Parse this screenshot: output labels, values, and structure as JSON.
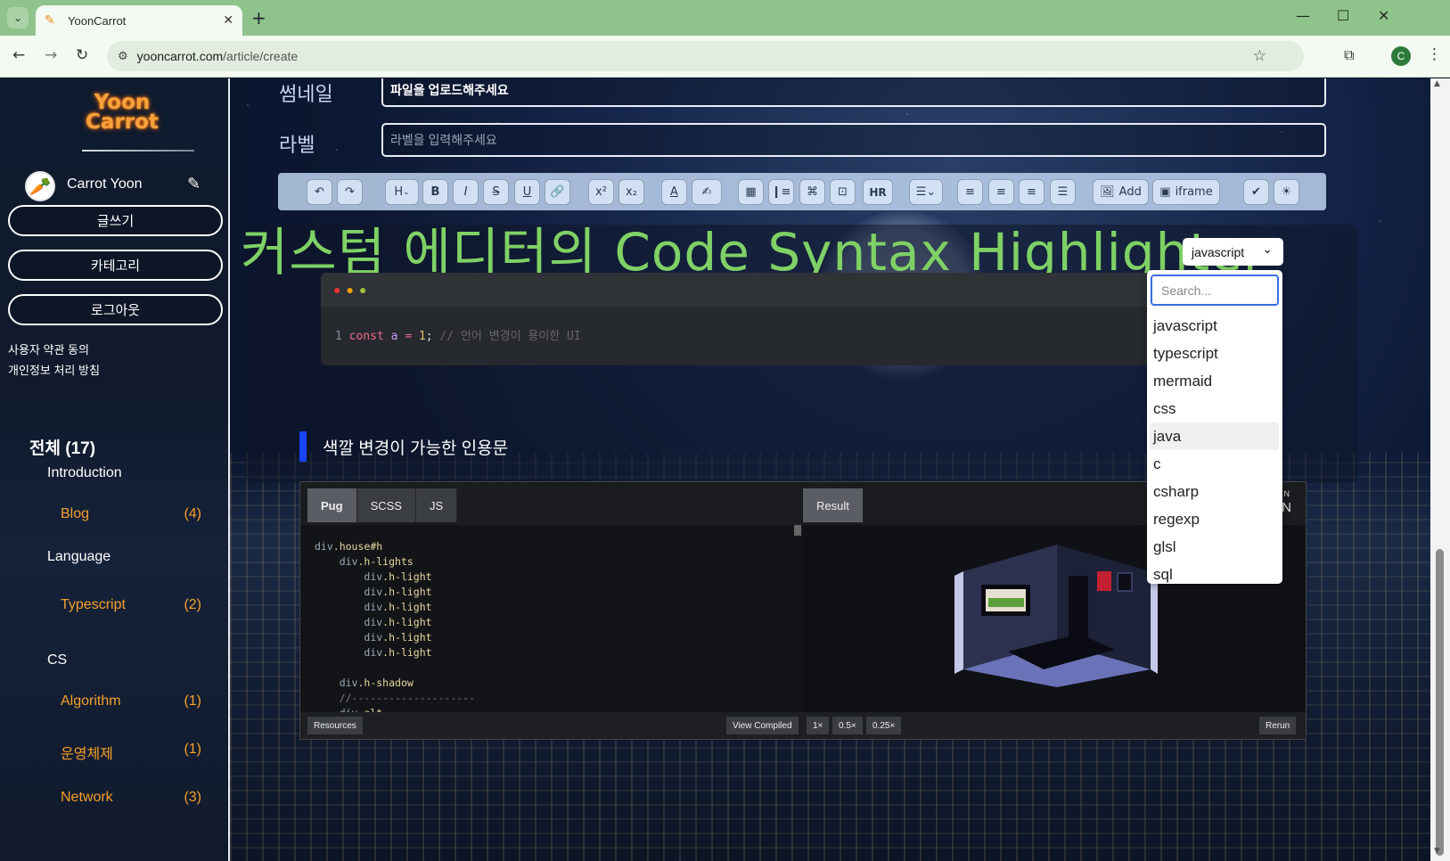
{
  "browser": {
    "tab_title": "YoonCarrot",
    "url_host": "yooncarrot.com",
    "url_path": "/article/create",
    "profile_initial": "C"
  },
  "sidebar": {
    "logo_line1": "Yoon",
    "logo_line2": "Carrot",
    "user_name": "Carrot Yoon",
    "buttons": [
      "글쓰기",
      "카테고리",
      "로그아웃"
    ],
    "links": [
      "사용자 약관 동의",
      "개인정보 처리 방침"
    ],
    "all_label": "전체 (17)",
    "groups": {
      "introduction": {
        "label": "Introduction",
        "items": [
          {
            "label": "Blog",
            "count": "(4)"
          }
        ]
      },
      "language": {
        "label": "Language",
        "items": [
          {
            "label": "Typescript",
            "count": "(2)"
          }
        ]
      },
      "cs": {
        "label": "CS",
        "items": [
          {
            "label": "Algorithm",
            "count": "(1)"
          },
          {
            "label": "운영체제",
            "count": "(1)"
          },
          {
            "label": "Network",
            "count": "(3)"
          }
        ]
      }
    }
  },
  "form": {
    "thumbnail_label": "썸네일",
    "thumbnail_value": "파일을 업로드해주세요",
    "label_label": "라벨",
    "label_placeholder": "라벨을 입력해주세요"
  },
  "toolbar": {
    "heading_btn": "H",
    "hr_btn": "HR",
    "add_btn": "Add",
    "iframe_btn": "iframe"
  },
  "editor": {
    "headline": "커스텀 에디터의 Code Syntax Highlighter",
    "code_line_number": "1",
    "code_keyword": "const",
    "code_var": "a",
    "code_op": "=",
    "code_num": "1",
    "code_semicolon": ";",
    "code_comment": "// 언어 변경이 용이한 UI",
    "quote_text": "색깔 변경이 가능한 인용문"
  },
  "language_select": {
    "selected": "javascript",
    "search_placeholder": "Search...",
    "options": [
      "javascript",
      "typescript",
      "mermaid",
      "css",
      "java",
      "c",
      "csharp",
      "regexp",
      "glsl",
      "sql"
    ],
    "hovered": "java"
  },
  "codepen": {
    "tabs": [
      "Pug",
      "SCSS",
      "JS"
    ],
    "result_tab": "Result",
    "code_lines": [
      {
        "indent": 0,
        "tag": "div",
        "cls": ".house#h"
      },
      {
        "indent": 1,
        "tag": "div",
        "cls": ".h-lights"
      },
      {
        "indent": 2,
        "tag": "div",
        "cls": ".h-light"
      },
      {
        "indent": 2,
        "tag": "div",
        "cls": ".h-light"
      },
      {
        "indent": 2,
        "tag": "div",
        "cls": ".h-light"
      },
      {
        "indent": 2,
        "tag": "div",
        "cls": ".h-light"
      },
      {
        "indent": 2,
        "tag": "div",
        "cls": ".h-light"
      },
      {
        "indent": 2,
        "tag": "div",
        "cls": ".h-light"
      },
      {
        "indent": 0,
        "tag": "",
        "cls": ""
      },
      {
        "indent": 1,
        "tag": "div",
        "cls": ".h-shadow"
      },
      {
        "indent": 1,
        "tag": "//--------------------",
        "cls": ""
      },
      {
        "indent": 1,
        "tag": "div",
        "cls": ".alt"
      }
    ],
    "footer": {
      "resources": "Resources",
      "view_compiled": "View Compiled",
      "zoom": [
        "1×",
        "0.5×",
        "0.25×"
      ],
      "rerun": "Rerun"
    },
    "corner_text_top": "O N",
    "corner_text_bottom": "N"
  }
}
